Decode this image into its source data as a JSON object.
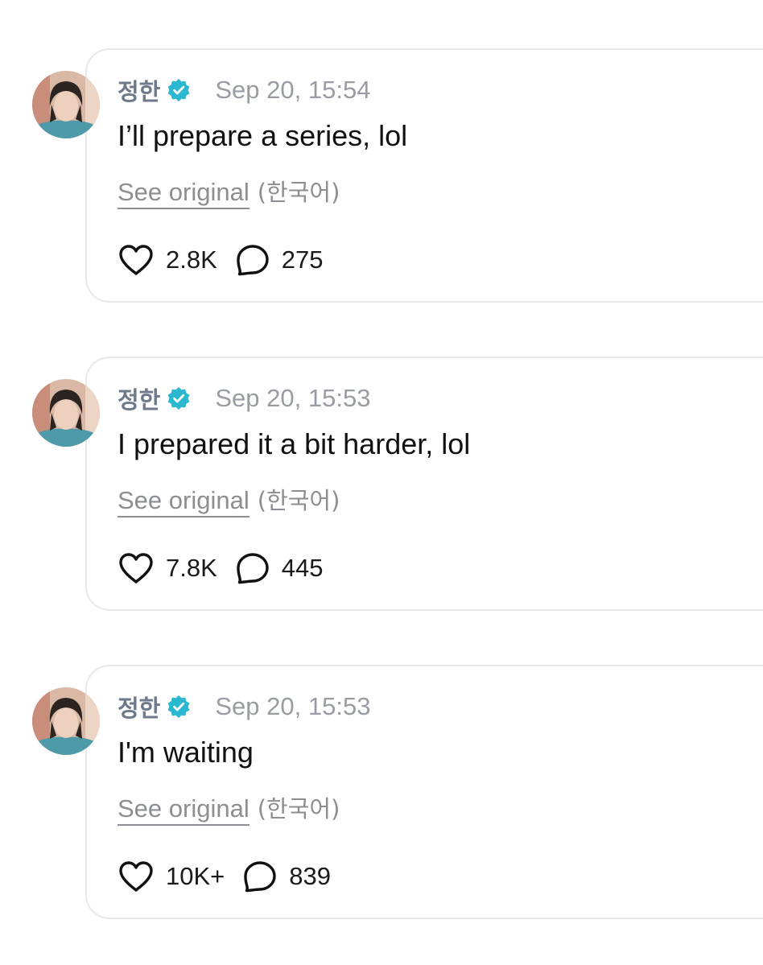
{
  "colors": {
    "username": "#6e7a8c",
    "verified_badge": "#29b8d0",
    "timestamp": "#9a9ca3",
    "card_border": "#e8e8ec"
  },
  "icons": {
    "like": "heart-icon",
    "comment": "speech-bubble-icon",
    "verified": "verified-badge-icon"
  },
  "posts": [
    {
      "username": "정한",
      "timestamp": "Sep 20, 15:54",
      "text": "I’ll prepare a series, lol",
      "see_original": "See original",
      "language": "(한국어)",
      "likes": "2.8K",
      "comments": "275"
    },
    {
      "username": "정한",
      "timestamp": "Sep 20, 15:53",
      "text": "I prepared it a bit harder, lol",
      "see_original": "See original",
      "language": "(한국어)",
      "likes": "7.8K",
      "comments": "445"
    },
    {
      "username": "정한",
      "timestamp": "Sep 20, 15:53",
      "text": "I'm waiting",
      "see_original": "See original",
      "language": "(한국어)",
      "likes": "10K+",
      "comments": "839"
    }
  ]
}
